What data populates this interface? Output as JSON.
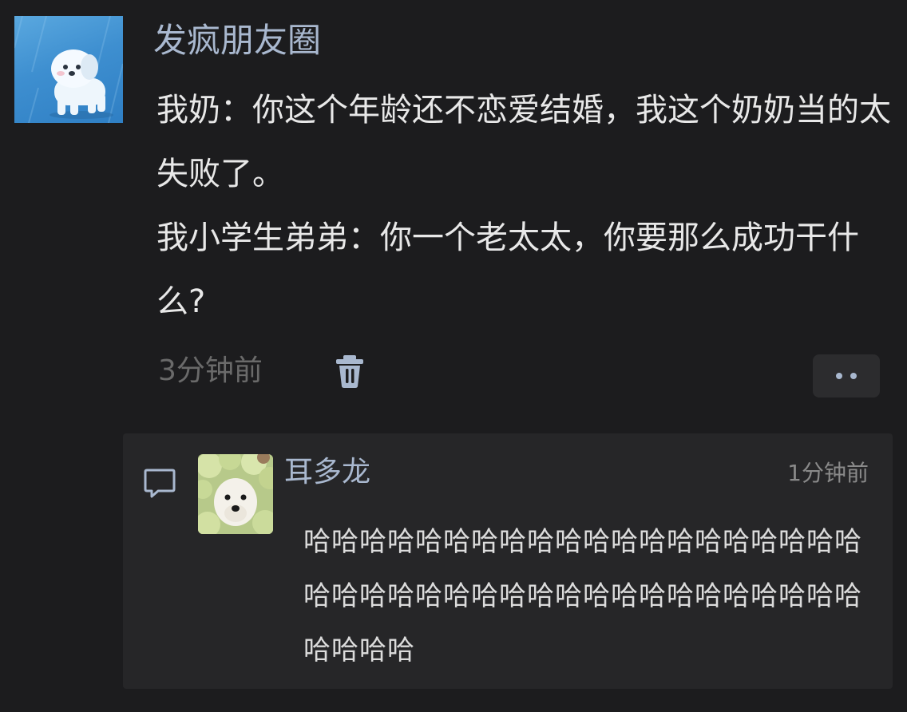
{
  "post": {
    "author_name": "发疯朋友圈",
    "body_paragraphs": [
      "我奶：你这个年龄还不恋爱结婚，我这个奶奶当的太失败了。",
      "我小学生弟弟：你一个老太太，你要那么成功干什么?"
    ],
    "timestamp": "3分钟前",
    "delete_icon": "trash-icon",
    "more_icon": "more-dots-icon"
  },
  "comment": {
    "icon": "comment-bubble-icon",
    "author_name": "耳多龙",
    "timestamp": "1分钟前",
    "text": "哈哈哈哈哈哈哈哈哈哈哈哈哈哈哈哈哈哈哈哈哈哈哈哈哈哈哈哈哈哈哈哈哈哈哈哈哈哈哈哈哈哈哈哈"
  },
  "colors": {
    "background": "#1c1c1e",
    "name_color": "#a9b8cf",
    "comment_panel": "#262628",
    "muted_text": "#6a6a6a"
  }
}
